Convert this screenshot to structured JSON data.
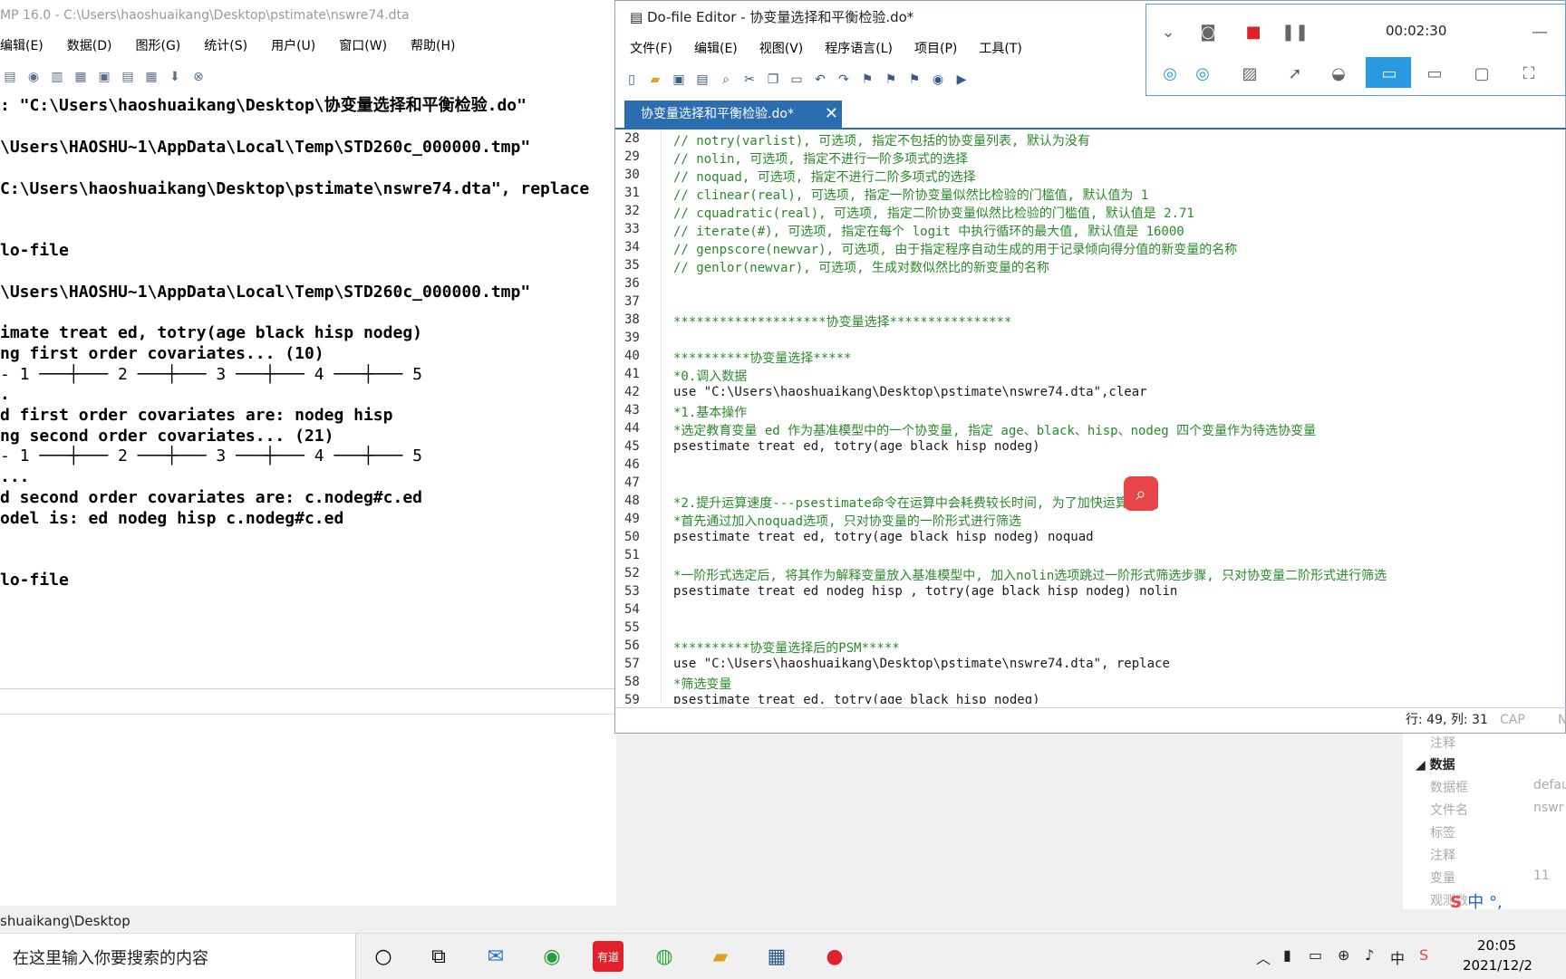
{
  "stata": {
    "title": "MP 16.0 - C:\\Users\\haoshuaikang\\Desktop\\pstimate\\nswre74.dta",
    "menu": [
      "编辑(E)",
      "数据(D)",
      "图形(G)",
      "统计(S)",
      "用户(U)",
      "窗口(W)",
      "帮助(H)"
    ],
    "results": [
      ": \"C:\\Users\\haoshuaikang\\Desktop\\协变量选择和平衡检验.do\"",
      "\\Users\\HAOSHU~1\\AppData\\Local\\Temp\\STD260c_000000.tmp\"",
      "C:\\Users\\haoshuaikang\\Desktop\\pstimate\\nswre74.dta\", replace",
      "lo-file",
      "\\Users\\HAOSHU~1\\AppData\\Local\\Temp\\STD260c_000000.tmp\"",
      "imate treat ed, totry(age black hisp nodeg)",
      "ng first order covariates... (10)",
      "- 1 ───┼─── 2 ───┼─── 3 ───┼─── 4 ───┼─── 5",
      ".",
      "d first order covariates are: nodeg hisp",
      "ng second order covariates... (21)",
      "- 1 ───┼─── 2 ───┼─── 3 ───┼─── 4 ───┼─── 5",
      "...",
      "d second order covariates are: c.nodeg#c.ed",
      "odel is: ed nodeg hisp c.nodeg#c.ed",
      "lo-file"
    ],
    "status_path": "shuaikang\\Desktop"
  },
  "properties": {
    "rows": [
      {
        "label": "注释",
        "value": ""
      },
      {
        "label": "数据",
        "value": ""
      },
      {
        "label": "数据框",
        "value": "defau"
      },
      {
        "label": "文件名",
        "value": "nswr"
      },
      {
        "label": "标签",
        "value": ""
      },
      {
        "label": "注释",
        "value": ""
      },
      {
        "label": "变量",
        "value": "11"
      },
      {
        "label": "观测数",
        "value": ""
      }
    ]
  },
  "dofile": {
    "title": "Do-file Editor - 协变量选择和平衡检验.do*",
    "menu": [
      "文件(F)",
      "编辑(E)",
      "视图(V)",
      "程序语言(L)",
      "项目(P)",
      "工具(T)"
    ],
    "tab_label": "协变量选择和平衡检验.do*",
    "tab_close": "✕",
    "lines": [
      {
        "n": "28",
        "t": "// notry(varlist), 可选项, 指定不包括的协变量列表, 默认为没有",
        "c": "cm"
      },
      {
        "n": "29",
        "t": "// nolin, 可选项, 指定不进行一阶多项式的选择",
        "c": "cm"
      },
      {
        "n": "30",
        "t": "// noquad, 可选项, 指定不进行二阶多项式的选择",
        "c": "cm"
      },
      {
        "n": "31",
        "t": "// clinear(real), 可选项, 指定一阶协变量似然比检验的门槛值, 默认值为 1",
        "c": "cm"
      },
      {
        "n": "32",
        "t": "// cquadratic(real), 可选项, 指定二阶协变量似然比检验的门槛值, 默认值是 2.71",
        "c": "cm"
      },
      {
        "n": "33",
        "t": "// iterate(#), 可选项, 指定在每个 logit 中执行循环的最大值, 默认值是 16000",
        "c": "cm"
      },
      {
        "n": "34",
        "t": "// genpscore(newvar), 可选项, 由于指定程序自动生成的用于记录倾向得分值的新变量的名称",
        "c": "cm"
      },
      {
        "n": "35",
        "t": "// genlor(newvar), 可选项, 生成对数似然比的新变量的名称",
        "c": "cm"
      },
      {
        "n": "36",
        "t": "",
        "c": "cd"
      },
      {
        "n": "37",
        "t": "",
        "c": "cd"
      },
      {
        "n": "38",
        "t": "********************协变量选择****************",
        "c": "cm"
      },
      {
        "n": "39",
        "t": "",
        "c": "cd"
      },
      {
        "n": "40",
        "t": "**********协变量选择*****",
        "c": "cm"
      },
      {
        "n": "41",
        "t": "*0.调入数据",
        "c": "cm"
      },
      {
        "n": "42",
        "t": "use \"C:\\Users\\haoshuaikang\\Desktop\\pstimate\\nswre74.dta\",clear",
        "c": "cd"
      },
      {
        "n": "43",
        "t": "*1.基本操作",
        "c": "cm"
      },
      {
        "n": "44",
        "t": "*选定教育变量 ed 作为基准模型中的一个协变量, 指定 age、black、hisp、nodeg 四个变量作为待选协变量",
        "c": "cm"
      },
      {
        "n": "45",
        "t": "psestimate treat ed, totry(age black hisp nodeg)",
        "c": "cd"
      },
      {
        "n": "46",
        "t": "",
        "c": "cd"
      },
      {
        "n": "47",
        "t": "",
        "c": "cd"
      },
      {
        "n": "48",
        "t": "*2.提升运算速度---psestimate命令在运算中会耗费较长时间, 为了加快运算速度,",
        "c": "cm"
      },
      {
        "n": "49",
        "t": "*首先通过加入noquad选项, 只对协变量的一阶形式进行筛选",
        "c": "cm"
      },
      {
        "n": "50",
        "t": "psestimate treat ed, totry(age black hisp nodeg) noquad",
        "c": "cd"
      },
      {
        "n": "51",
        "t": "",
        "c": "cd"
      },
      {
        "n": "52",
        "t": "*一阶形式选定后, 将其作为解释变量放入基准模型中, 加入nolin选项跳过一阶形式筛选步骤, 只对协变量二阶形式进行筛选",
        "c": "cm"
      },
      {
        "n": "53",
        "t": "psestimate treat ed nodeg hisp , totry(age black hisp nodeg) nolin",
        "c": "cd"
      },
      {
        "n": "54",
        "t": "",
        "c": "cd"
      },
      {
        "n": "55",
        "t": "",
        "c": "cd"
      },
      {
        "n": "56",
        "t": "**********协变量选择后的PSM*****",
        "c": "cm"
      },
      {
        "n": "57",
        "t": "use \"C:\\Users\\haoshuaikang\\Desktop\\pstimate\\nswre74.dta\", replace",
        "c": "cd"
      },
      {
        "n": "58",
        "t": "*筛选变量",
        "c": "cm"
      },
      {
        "n": "59",
        "t": "psestimate treat ed, totry(age black hisp nodeg)",
        "c": "cd"
      }
    ],
    "cursor_pos": "行: 49, 列: 31",
    "caps": "CAP",
    "num": "N"
  },
  "recorder": {
    "time": "00:02:30"
  },
  "taskbar": {
    "search_placeholder": "在这里输入你要搜索的内容",
    "time": "20:05",
    "date": "2021/12/2"
  },
  "ime": {
    "label": "中 °,"
  }
}
